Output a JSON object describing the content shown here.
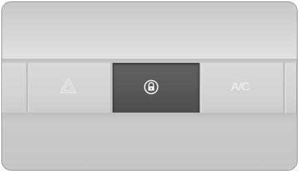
{
  "panel": {
    "buttons": [
      {
        "name": "hazard",
        "icon": "warning-triangle-icon",
        "label": ""
      },
      {
        "name": "lock",
        "icon": "padlock-icon",
        "label": "",
        "pressed": true
      },
      {
        "name": "ac",
        "icon": "",
        "label": "A/C"
      }
    ]
  },
  "colors": {
    "panel_gray": "#d2d2d2",
    "pressed_button": "#575757",
    "icon_light": "#f4f4f4",
    "frame_border": "#8d8d8d"
  }
}
